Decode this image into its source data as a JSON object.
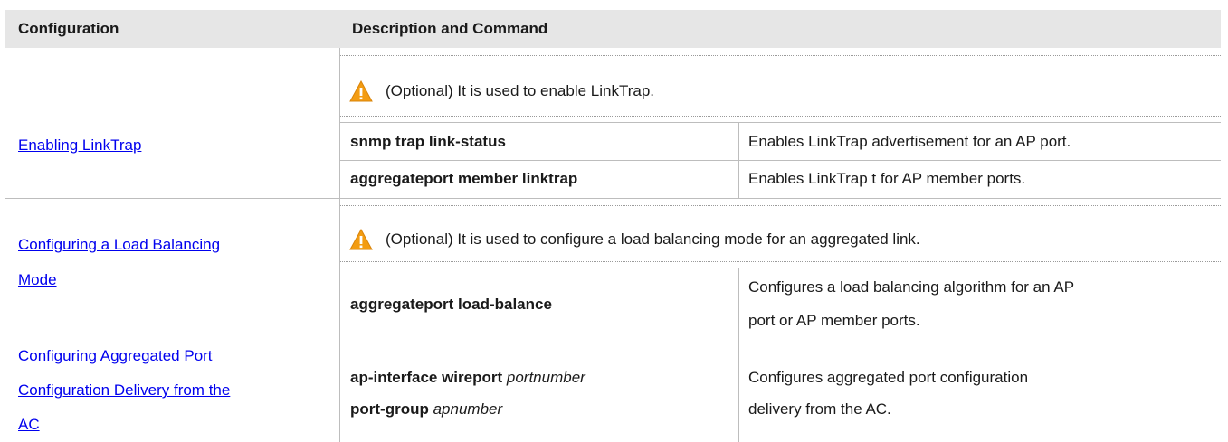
{
  "table": {
    "header": {
      "col1": "Configuration",
      "col2": "Description and Command"
    },
    "rows": [
      {
        "config_link": "Enabling LinkTrap",
        "note": "(Optional) It is used to enable LinkTrap.",
        "commands": [
          {
            "command": "snmp trap link-status",
            "description": "Enables LinkTrap advertisement for an AP port."
          },
          {
            "command": "aggregateport member linktrap",
            "description": "Enables LinkTrap t for AP member ports."
          }
        ]
      },
      {
        "config_link_line1": "Configuring a Load Balancing",
        "config_link_line2": "Mode",
        "note": "(Optional) It is used to configure a load balancing mode for an aggregated link.",
        "commands": [
          {
            "command": "aggregateport load-balance",
            "description_line1": "Configures a load balancing algorithm for an AP",
            "description_line2": "port or AP member ports."
          }
        ]
      },
      {
        "config_link_line1": "Configuring Aggregated Port",
        "config_link_line2": "Configuration Delivery from the",
        "config_link_line3": "AC",
        "command_line1_bold": "ap-interface wireport",
        "command_line1_italic": "portnumber",
        "command_line2_bold": "port-group",
        "command_line2_italic": "apnumber",
        "description_line1": "Configures aggregated port configuration",
        "description_line2": "delivery from the AC."
      }
    ]
  },
  "icons": {
    "warning": "warning-triangle-icon"
  },
  "colors": {
    "header_bg": "#e6e6e6",
    "link": "#0000ee",
    "warning": "#f39c12"
  }
}
